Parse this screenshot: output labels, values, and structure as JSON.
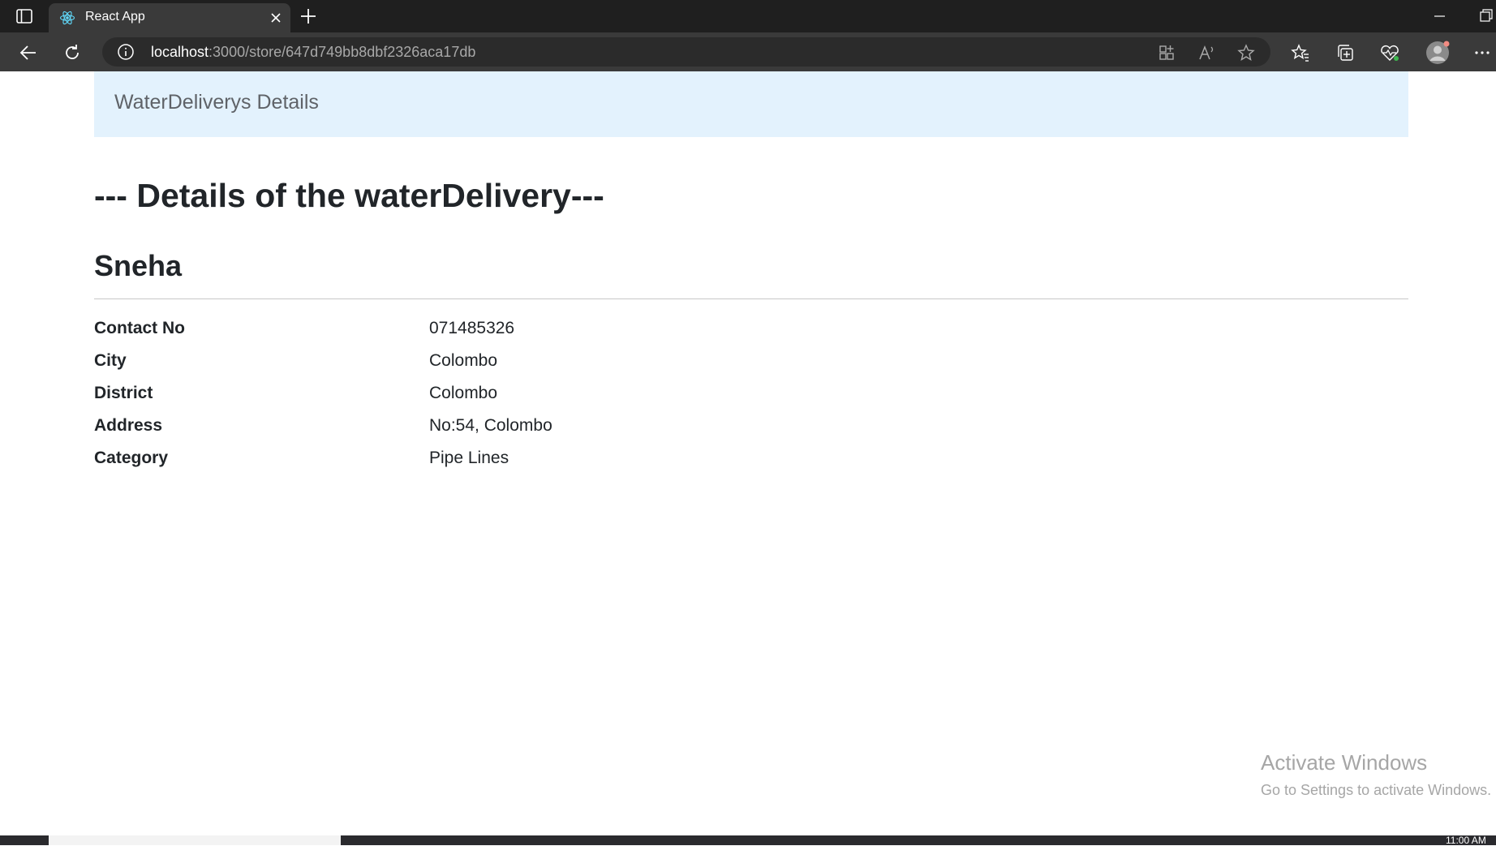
{
  "browser": {
    "tab_title": "React App",
    "url_host": "localhost",
    "url_rest": ":3000/store/647d749bb8dbf2326aca17db"
  },
  "page": {
    "navbar_brand": "WaterDeliverys Details",
    "heading": "--- Details of the waterDelivery---",
    "name": "Sneha",
    "details": [
      {
        "label": "Contact No",
        "value": "071485326"
      },
      {
        "label": "City",
        "value": "Colombo"
      },
      {
        "label": "District",
        "value": "Colombo"
      },
      {
        "label": "Address",
        "value": "No:54, Colombo"
      },
      {
        "label": "Category",
        "value": "Pipe Lines"
      }
    ]
  },
  "watermark": {
    "title": "Activate Windows",
    "subtitle": "Go to Settings to activate Windows."
  },
  "taskbar": {
    "time": "11:00 AM"
  },
  "colors": {
    "navbar_bg": "#e3f2fd",
    "chrome_dark": "#1f1f1f",
    "toolbar": "#3a3a3a"
  },
  "icons": [
    "sidebar-icon",
    "react-logo-icon",
    "close-icon",
    "plus-icon",
    "minimize-icon",
    "restore-icon",
    "back-icon",
    "refresh-icon",
    "info-icon",
    "app-available-icon",
    "read-aloud-icon",
    "star-icon",
    "favorites-icon",
    "collections-icon",
    "browser-essentials-icon",
    "profile-icon",
    "more-icon"
  ]
}
